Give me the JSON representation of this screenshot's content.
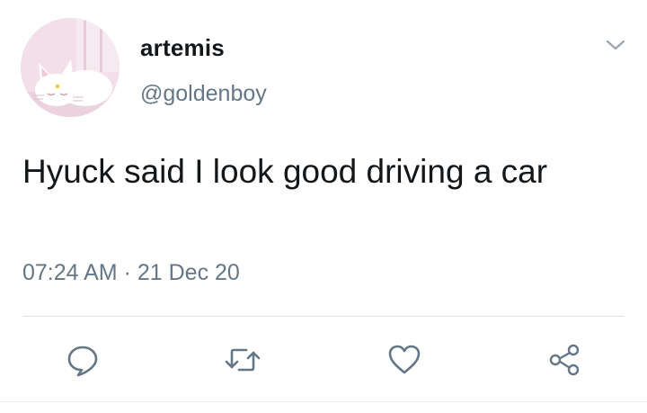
{
  "user": {
    "display_name": "artemis",
    "handle": "@goldenboy",
    "avatar_icon": "white-cat-avatar"
  },
  "tweet": {
    "text": "Hyuck said I look good driving a car",
    "time": "07:24 AM",
    "separator": "·",
    "date": "21 Dec 20"
  },
  "actions": {
    "reply_icon": "speech-bubble-icon",
    "retweet_icon": "retweet-icon",
    "like_icon": "heart-icon",
    "share_icon": "share-icon"
  },
  "colors": {
    "text": "#14171a",
    "secondary": "#657786",
    "divider": "#dfe3e7"
  }
}
